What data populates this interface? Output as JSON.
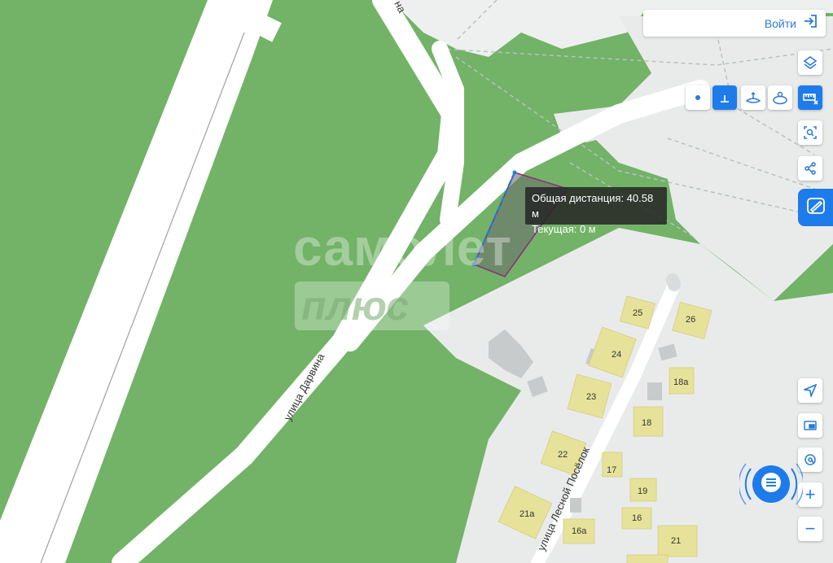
{
  "header": {
    "login_label": "Войти"
  },
  "measure_tooltip": {
    "total_line": "Общая дистанция: 40.58 м",
    "current_line": "Текущая: 0 м"
  },
  "watermark": {
    "line1": "самолет",
    "line2": "плюс"
  },
  "streets": {
    "darwin": "улица Дарвина",
    "darwin_fragment": "на",
    "lesnoy": "улица Лесной Посёлок"
  },
  "house_numbers": [
    "25",
    "26",
    "24",
    "18а",
    "23",
    "18",
    "22",
    "17",
    "19",
    "21а",
    "16",
    "16а",
    "21"
  ],
  "controls": {
    "layers": "layers-icon",
    "measure_point": "point-icon",
    "measure_line": "line-icon",
    "measure_area": "area-icon",
    "measure_circle": "radius-icon",
    "ruler": "ruler-icon",
    "select_area": "select-area-icon",
    "share": "share-icon",
    "locate": "locate-icon",
    "panorama": "panorama-icon",
    "address": "address-icon",
    "zoom_in": "+",
    "zoom_out": "−",
    "chat": "chat-icon"
  },
  "colors": {
    "forest": "#72b367",
    "clearing": "#e8eaea",
    "road": "#ffffff",
    "building": "#e6e29a",
    "accent": "#1e7bea",
    "measure_polygon": "#8a2d7a"
  }
}
